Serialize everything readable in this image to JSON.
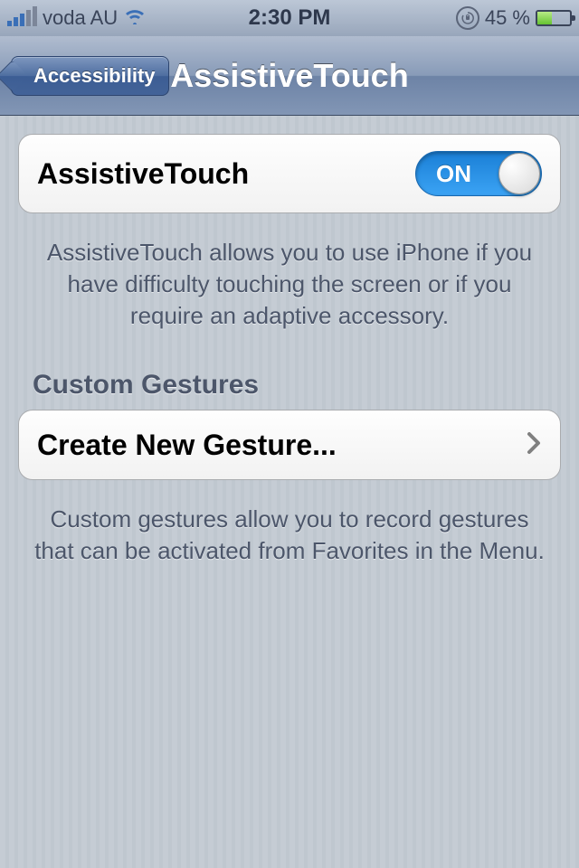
{
  "status": {
    "carrier": "voda AU",
    "time": "2:30 PM",
    "battery_pct": "45 %"
  },
  "nav": {
    "back_label": "Accessibility",
    "title": "AssistiveTouch"
  },
  "toggle_row": {
    "label": "AssistiveTouch",
    "on_text": "ON",
    "state": "on"
  },
  "toggle_footer": "AssistiveTouch allows you to use iPhone if you have difficulty touching the screen or if you require an adaptive accessory.",
  "gestures_header": "Custom Gestures",
  "create_row": {
    "label": "Create New Gesture..."
  },
  "gestures_footer": "Custom gestures allow you to record gestures that can be activated from Favorites in the Menu."
}
